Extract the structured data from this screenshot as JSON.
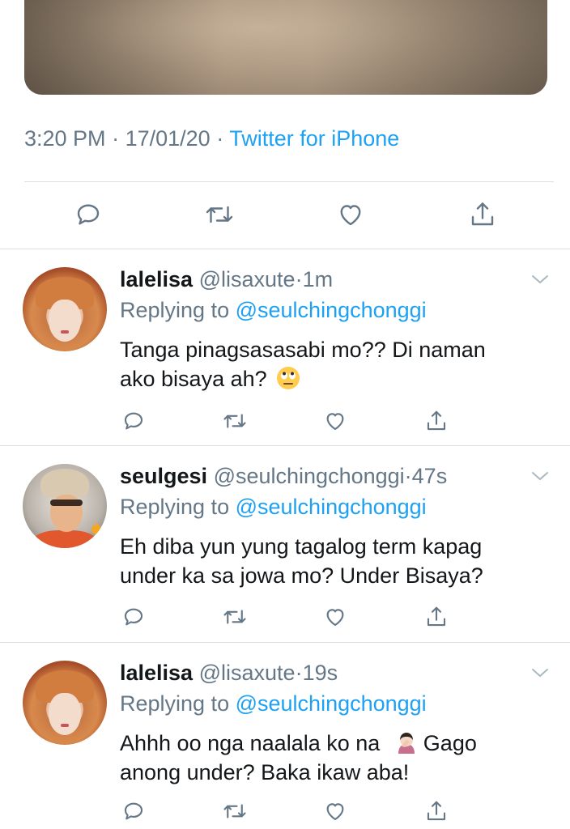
{
  "main_tweet": {
    "time": "3:20 PM",
    "separator": "·",
    "date": "17/01/20",
    "source": "Twitter for iPhone",
    "actions": [
      "reply-icon",
      "retweet-icon",
      "like-icon",
      "share-icon"
    ]
  },
  "replies": [
    {
      "name": "lalelisa",
      "handle": "@lisaxute",
      "time": "1m",
      "replying_prefix": "Replying to",
      "replying_to": "@seulchingchonggi",
      "line1": "Tanga pinagsasasabi mo?? Di naman",
      "line2": "ako bisaya ah?",
      "emoji": "face-with-rolling-eyes"
    },
    {
      "name": "seulgesi",
      "handle": "@seulchingchonggi",
      "time": "47s",
      "replying_prefix": "Replying to",
      "replying_to": "@seulchingchonggi",
      "line1": "Eh diba yun yung tagalog term kapag",
      "line2": "under ka sa jowa mo? Under Bisaya?"
    },
    {
      "name": "lalelisa",
      "handle": "@lisaxute",
      "time": "19s",
      "replying_prefix": "Replying to",
      "replying_to": "@seulchingchonggi",
      "line1a": "Ahhh oo nga naalala ko na",
      "line1b": "Gago",
      "line2": "anong under? Baka ikaw aba!",
      "emoji": "person-facepalming"
    }
  ],
  "colors": {
    "accent": "#1da1f2",
    "secondary_text": "#657786",
    "icon": "#657786",
    "divider": "#d9dee2"
  }
}
